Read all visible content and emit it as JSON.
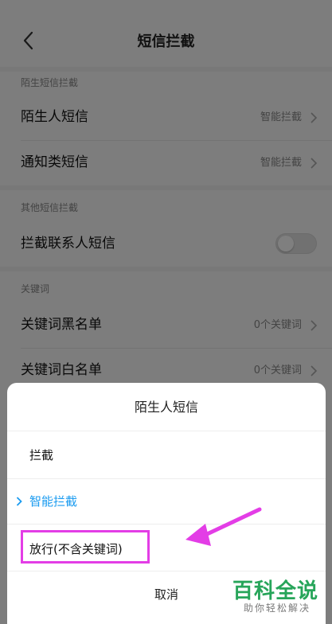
{
  "header": {
    "title": "短信拦截"
  },
  "section_stranger": {
    "label": "陌生短信拦截",
    "rows": [
      {
        "label": "陌生人短信",
        "value": "智能拦截"
      },
      {
        "label": "通知类短信",
        "value": "智能拦截"
      }
    ]
  },
  "section_other": {
    "label": "其他短信拦截",
    "rows": [
      {
        "label": "拦截联系人短信",
        "toggle_on": false
      }
    ]
  },
  "section_keywords": {
    "label": "关键词",
    "rows": [
      {
        "label": "关键词黑名单",
        "value": "0个关键词"
      },
      {
        "label": "关键词白名单",
        "value": "0个关键词"
      }
    ]
  },
  "sheet": {
    "title": "陌生人短信",
    "options": [
      {
        "label": "拦截",
        "selected": false
      },
      {
        "label": "智能拦截",
        "selected": true
      },
      {
        "label": "放行(不含关键词)",
        "selected": false
      }
    ],
    "cancel_label": "取消"
  },
  "annotations": {
    "highlight_color": "#e33de6",
    "arrow_color": "#e33de6"
  },
  "watermark": {
    "main": "百科全说",
    "sub": "助你轻松解决"
  },
  "colors": {
    "accent": "#1a9bf0"
  }
}
